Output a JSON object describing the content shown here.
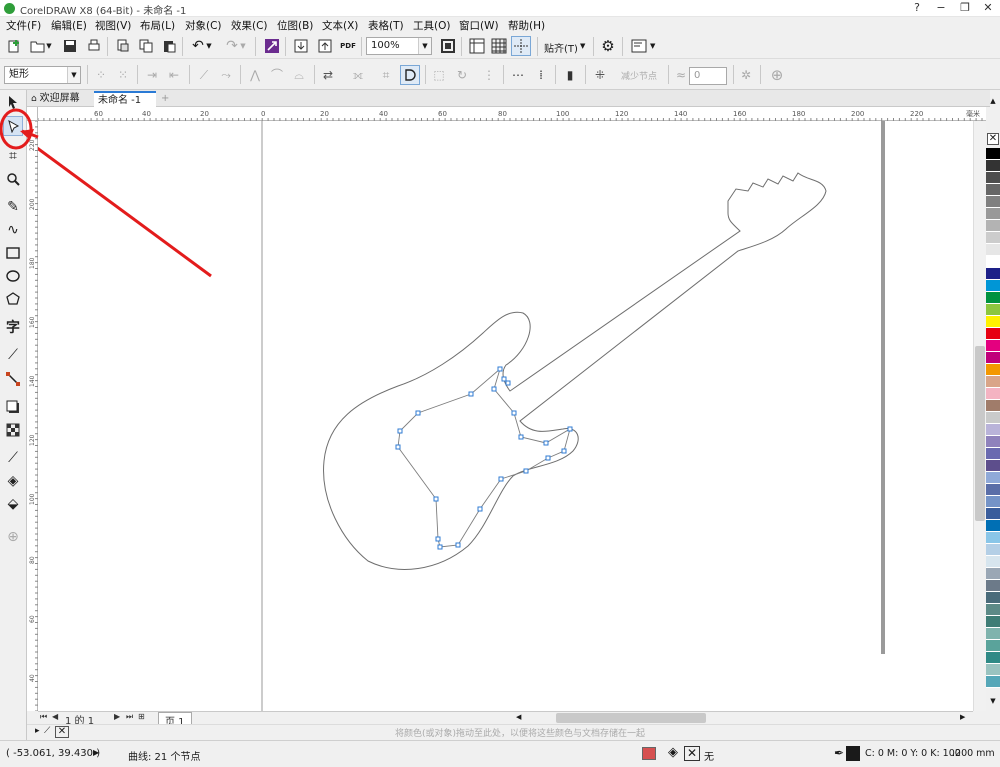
{
  "window": {
    "title": "CorelDRAW X8 (64-Bit) - 未命名 -1",
    "minimize": "−",
    "restore": "❐",
    "close": "✕",
    "help_glyph": "?"
  },
  "menu": [
    "文件(F)",
    "编辑(E)",
    "视图(V)",
    "布局(L)",
    "对象(C)",
    "效果(C)",
    "位图(B)",
    "文本(X)",
    "表格(T)",
    "工具(O)",
    "窗口(W)",
    "帮助(H)"
  ],
  "standard_toolbar": {
    "zoom_value": "100%",
    "snap_label": "贴齐(T)",
    "pdf_label": "PDF"
  },
  "property_bar": {
    "shape_select": "矩形",
    "reduce_nodes_label": "减少节点",
    "smoothness_value": "0"
  },
  "tabs": [
    {
      "label": "欢迎屏幕"
    },
    {
      "label": "未命名 -1"
    },
    {
      "label": "+"
    }
  ],
  "ruler": {
    "h_labels": [
      "60",
      "40",
      "20",
      "0",
      "20",
      "40",
      "60",
      "80",
      "100",
      "120",
      "140",
      "160",
      "180",
      "200",
      "220"
    ],
    "unit": "毫米",
    "v_labels": [
      "220",
      "200",
      "180",
      "160",
      "140",
      "120",
      "100",
      "80",
      "60",
      "40",
      "20"
    ]
  },
  "page_nav": {
    "position": "1 的 1",
    "page_tab": "页 1"
  },
  "color_bar_hint": "将颜色(或对象)拖动至此处，以便将这些颜色与文档存储在一起",
  "status": {
    "coords": "( -53.061, 39.430 )",
    "selection_info": "曲线: 21 个节点",
    "fill_none": "无",
    "outline_color": "C: 0 M: 0 Y: 0 K: 100",
    "outline_width": ".200 mm"
  },
  "palette_colors": [
    "#000000",
    "#333333",
    "#4d4d4d",
    "#666666",
    "#808080",
    "#999999",
    "#b3b3b3",
    "#cccccc",
    "#e6e6e6",
    "#ffffff",
    "#1d2088",
    "#0096d6",
    "#00923f",
    "#8cc63f",
    "#fff100",
    "#e60012",
    "#e4007f",
    "#c0007a",
    "#f39800",
    "#d9a588",
    "#f4b3c2",
    "#a07c6a",
    "#c9caca",
    "#b9b3d9",
    "#8f82bc",
    "#6a6ab0",
    "#5d4e8c",
    "#8fa9d8",
    "#5a6ea8",
    "#7493c7",
    "#3a5d9c",
    "#006fb4",
    "#8ac6e8",
    "#b4cfe6",
    "#d7e5ee",
    "#9aa7b5",
    "#6c7a89",
    "#4a6b7a",
    "#5d8a87",
    "#3f7d76",
    "#7fb3ad",
    "#5aa39b",
    "#2f8a86",
    "#9ac3c0",
    "#56a7b8"
  ],
  "colors": {
    "accent": "#2a7ad5",
    "annotation": "#e31c1c",
    "node": "#2f7bd3"
  }
}
